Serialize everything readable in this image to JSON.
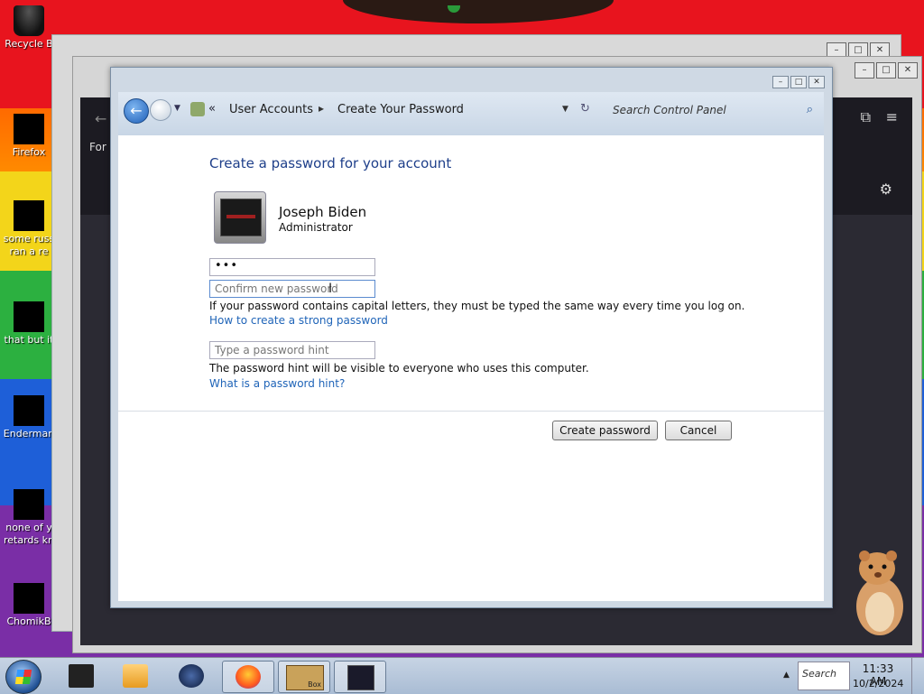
{
  "desktop": {
    "icons": [
      {
        "label": "Recycle B",
        "icon": "recycle-bin-icon"
      },
      {
        "label": "Firefox",
        "icon": "firefox-icon"
      },
      {
        "label": "some russ ran a re",
        "icon": "document-icon"
      },
      {
        "label": "that but it",
        "icon": "folder-icon"
      },
      {
        "label": "Enderman",
        "icon": "app-icon"
      },
      {
        "label": "none of y retards kn",
        "icon": "app-icon"
      },
      {
        "label": "ChomikB",
        "icon": "hamster-icon"
      }
    ]
  },
  "background_window": {
    "text_fragment": "For c",
    "gear_icon": "gear-icon",
    "extensions_icon": "puzzle-icon",
    "menu_icon": "hamburger-icon"
  },
  "window": {
    "address": {
      "chevrons": "«",
      "crumb1": "User Accounts",
      "separator": "▸",
      "crumb2": "Create Your Password",
      "search_placeholder": "Search Control Panel"
    },
    "heading": "Create a password for your account",
    "user": {
      "name": "Joseph Biden",
      "role": "Administrator"
    },
    "new_password_value": "•••",
    "confirm_placeholder": "Confirm new password",
    "capital_note": "If your password contains capital letters, they must be typed the same way every time you log on.",
    "strong_link": "How to create a strong password",
    "hint_placeholder": "Type a password hint",
    "hint_note": "The password hint will be visible to everyone who uses this computer.",
    "hint_link": "What is a password hint?",
    "create_button": "Create password",
    "cancel_button": "Cancel"
  },
  "taskbar": {
    "items": [
      {
        "name": "taskbar-item-1",
        "icon": "monitor-icon"
      },
      {
        "name": "taskbar-item-2",
        "icon": "media-player-icon"
      },
      {
        "name": "taskbar-item-3",
        "icon": "globe-icon"
      },
      {
        "name": "taskbar-item-firefox",
        "icon": "firefox-icon"
      },
      {
        "name": "taskbar-item-box",
        "icon": "hamster-box-icon",
        "label": "Box"
      },
      {
        "name": "taskbar-item-control-panel",
        "icon": "control-panel-icon"
      }
    ],
    "search_text": "Search",
    "time": "11:33 AM",
    "date": "10/2/2024"
  },
  "colors": {
    "link": "#1f64b8",
    "heading": "#1e3f8a",
    "taskbar": "#b8c8dc"
  }
}
